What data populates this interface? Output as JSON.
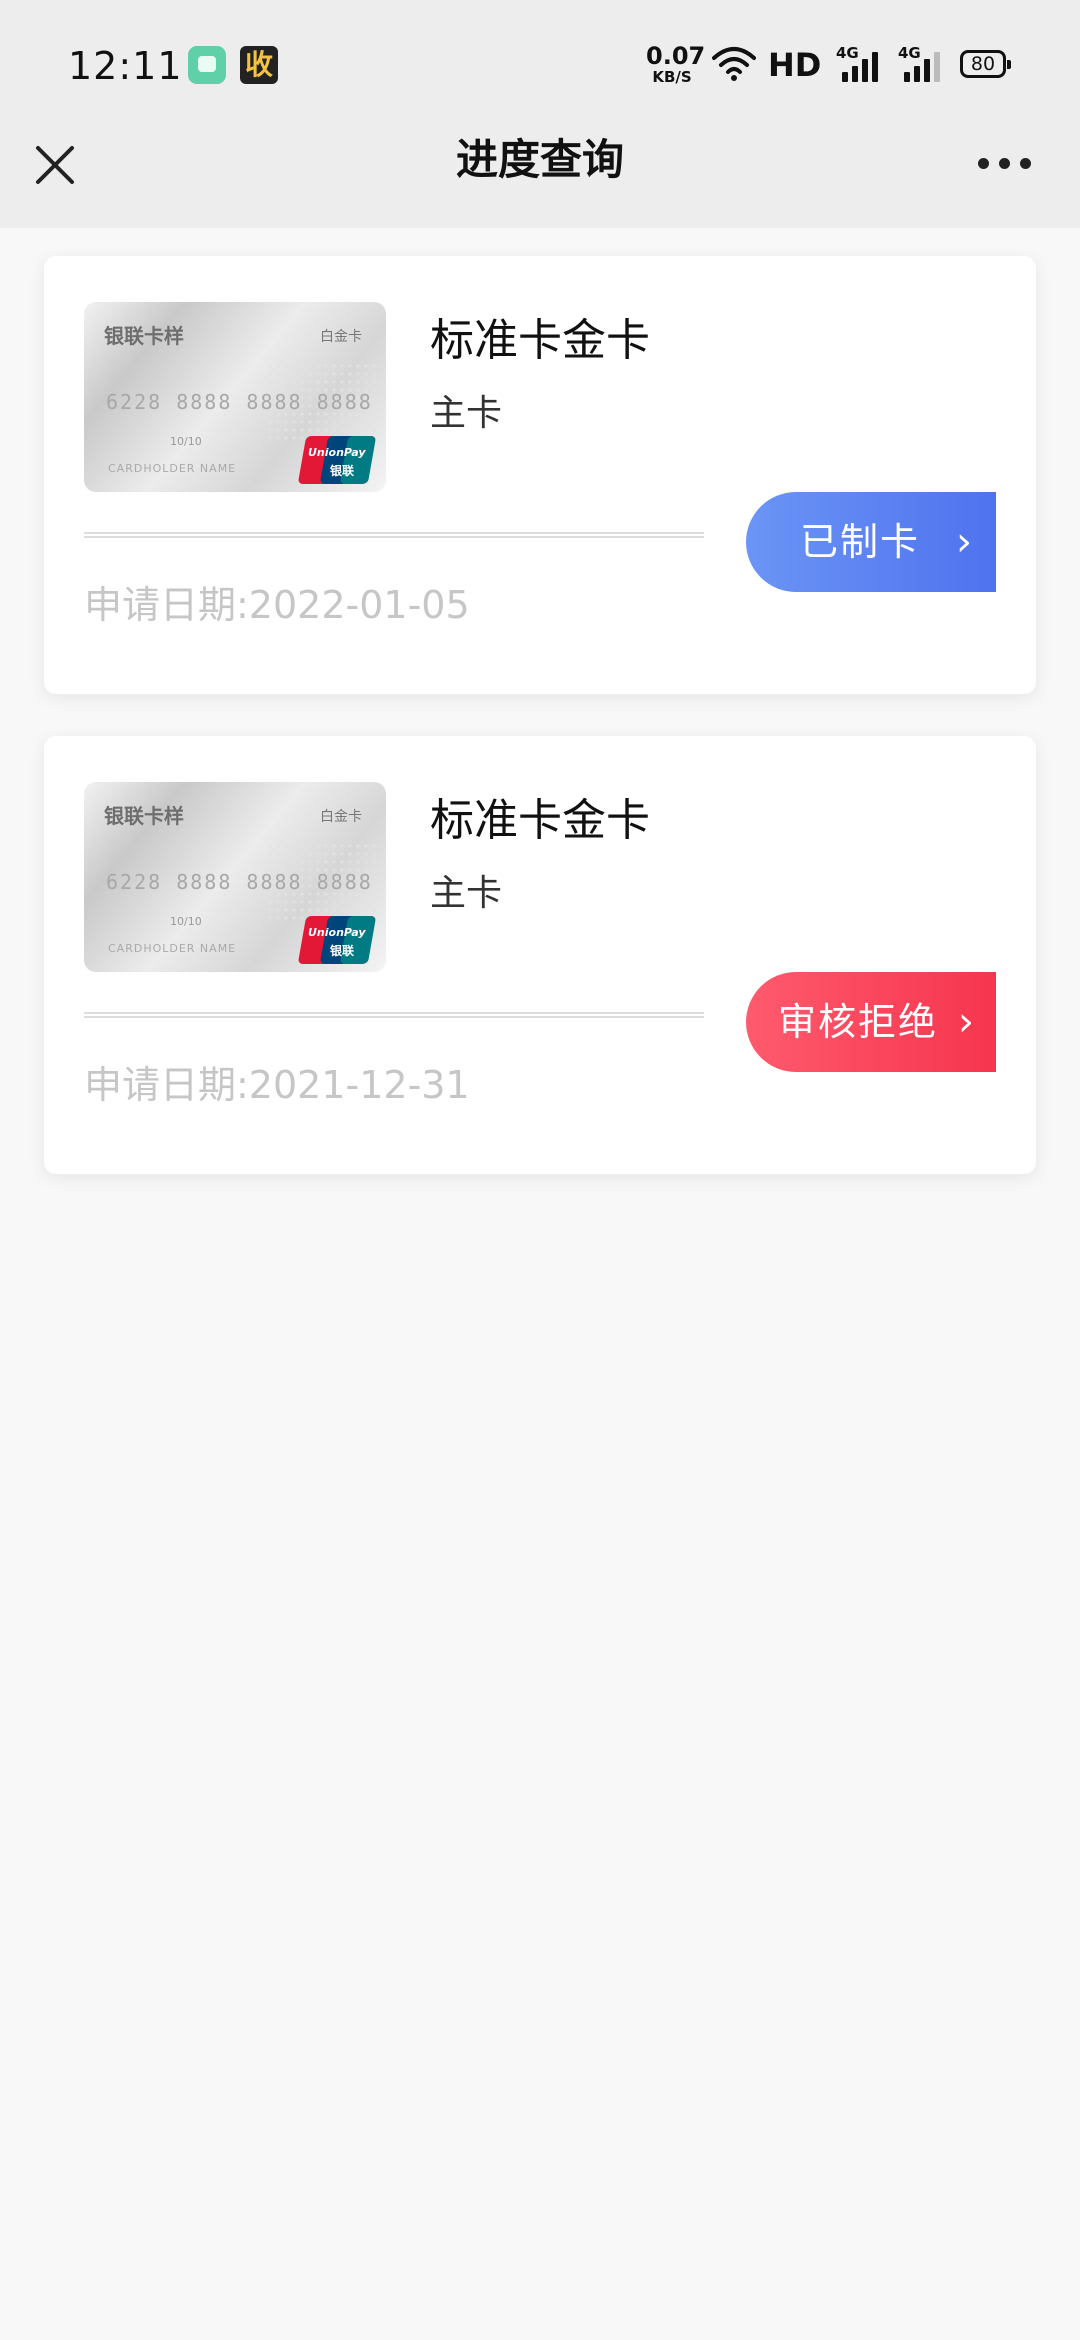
{
  "status_bar": {
    "time": "12:11",
    "app_icon_2_label": "收",
    "net_speed_value": "0.07",
    "net_speed_unit": "KB/S",
    "hd_label": "HD",
    "signal_1_label": "4G",
    "signal_2_label": "4G",
    "battery_level": "80"
  },
  "header": {
    "title": "进度查询",
    "close_icon": "close-icon",
    "more_icon": "more-icon"
  },
  "bank_card_image": {
    "title": "银联卡样",
    "tier": "白金卡",
    "number": "6228 8888 8888 8888",
    "valid": "10/10",
    "holder": "CARDHOLDER NAME",
    "logo_text_1": "UnionPay",
    "logo_text_2": "银联"
  },
  "applications": [
    {
      "card_name": "标准卡金卡",
      "card_type": "主卡",
      "apply_date": "申请日期:2022-01-05",
      "status_label": "已制卡",
      "status_color": "#5b82f2"
    },
    {
      "card_name": "标准卡金卡",
      "card_type": "主卡",
      "apply_date": "申请日期:2021-12-31",
      "status_label": "审核拒绝",
      "status_color": "#f8425a"
    }
  ],
  "colors": {
    "background": "#f8f8f8",
    "header_background": "#ededed",
    "date_text": "#c6c6c6"
  }
}
